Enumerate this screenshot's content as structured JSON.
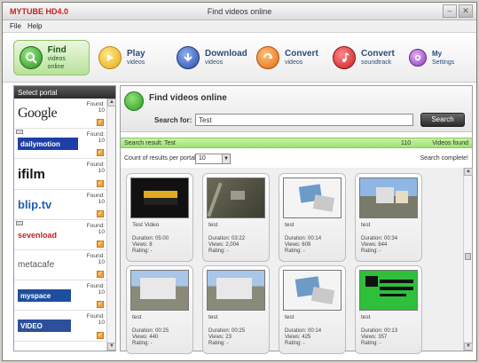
{
  "app": {
    "name": "MYTUBE HD4.0",
    "window_title": "Find videos online"
  },
  "menu": [
    "File",
    "Help"
  ],
  "toolbar": [
    {
      "big": "Find",
      "small": "videos online",
      "active": true
    },
    {
      "big": "Play",
      "small": "videos"
    },
    {
      "big": "Download",
      "small": "videos"
    },
    {
      "big": "Convert",
      "small": "videos"
    },
    {
      "big": "Convert",
      "small": "soundtrack"
    },
    {
      "big": "My",
      "small": "Settings"
    }
  ],
  "sidebar": {
    "header": "Select portal",
    "portals": [
      {
        "name": "Google",
        "found_label": "Found:",
        "found": "10"
      },
      {
        "name": "dailymotion",
        "found_label": "Found:",
        "found": "10"
      },
      {
        "name": "ifilm",
        "found_label": "Found:",
        "found": "10"
      },
      {
        "name": "blip.tv",
        "found_label": "Found:",
        "found": "10"
      },
      {
        "name": "sevenload",
        "found_label": "Found:",
        "found": "10"
      },
      {
        "name": "metacafe",
        "found_label": "Found:",
        "found": "10"
      },
      {
        "name": "myspace",
        "found_label": "Found:",
        "found": "10"
      },
      {
        "name": "VIDEO",
        "found_label": "Found:",
        "found": "10"
      }
    ]
  },
  "main": {
    "title": "Find videos online",
    "search_label": "Search for:",
    "search_value": "Test",
    "search_button": "Search",
    "result_label": "Search result: Test",
    "result_count": "110",
    "result_found": "Videos found",
    "count_label": "Count of results per portal:",
    "count_value": "10",
    "status": "Search complete!"
  },
  "videos": [
    {
      "title": "Test Video",
      "duration": "Duration: 05:00",
      "views": "Views: 8",
      "rating": "Rating: -"
    },
    {
      "title": "test",
      "duration": "Duration: 03:22",
      "views": "Views: 2,004",
      "rating": "Rating: -"
    },
    {
      "title": "test",
      "duration": "Duration: 00:14",
      "views": "Views: 609",
      "rating": "Rating: -"
    },
    {
      "title": "test",
      "duration": "Duration: 00:34",
      "views": "Views: 844",
      "rating": "Rating: -"
    },
    {
      "title": "test",
      "duration": "Duration: 00:25",
      "views": "Views: 440",
      "rating": "Rating: -"
    },
    {
      "title": "test",
      "duration": "Duration: 00:25",
      "views": "Views: 23",
      "rating": "Rating: -"
    },
    {
      "title": "test",
      "duration": "Duration: 00:14",
      "views": "Views: 425",
      "rating": "Rating: -"
    },
    {
      "title": "test",
      "duration": "Duration: 00:13",
      "views": "Views: 357",
      "rating": "Rating: -"
    }
  ],
  "colors": {
    "accent_red": "#c62121",
    "green": "#2d9a1f",
    "result_bar": "#b3ea8a"
  }
}
